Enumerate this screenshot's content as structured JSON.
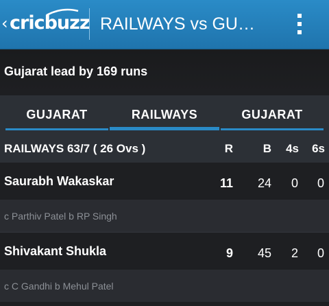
{
  "appbar": {
    "logo_text": "cricbuzz",
    "title": "RAILWAYS vs GU…",
    "back_icon": "chevron-left-icon",
    "menu_icon": "overflow-menu-icon"
  },
  "status": {
    "text": "Gujarat lead by 169 runs"
  },
  "tabs": [
    {
      "label": "GUJARAT"
    },
    {
      "label": "RAILWAYS"
    },
    {
      "label": "GUJARAT"
    }
  ],
  "scorecard": {
    "innings": "RAILWAYS 63/7 ( 26 Ovs )",
    "columns": {
      "r": "R",
      "b": "B",
      "fours": "4s",
      "sixes": "6s"
    },
    "batsmen": [
      {
        "name": "Saurabh Wakaskar",
        "runs": "11",
        "balls": "24",
        "fours": "0",
        "sixes": "0",
        "dismissal": "c Parthiv Patel b RP Singh"
      },
      {
        "name": "Shivakant Shukla",
        "runs": "9",
        "balls": "45",
        "fours": "2",
        "sixes": "0",
        "dismissal": "c C Gandhi b Mehul Patel"
      }
    ]
  },
  "colors": {
    "appbar": "#2a8bc7",
    "tab_indicator": "#2a8bc7",
    "background": "#1e1f22",
    "dismissal_text": "#8c9096"
  }
}
